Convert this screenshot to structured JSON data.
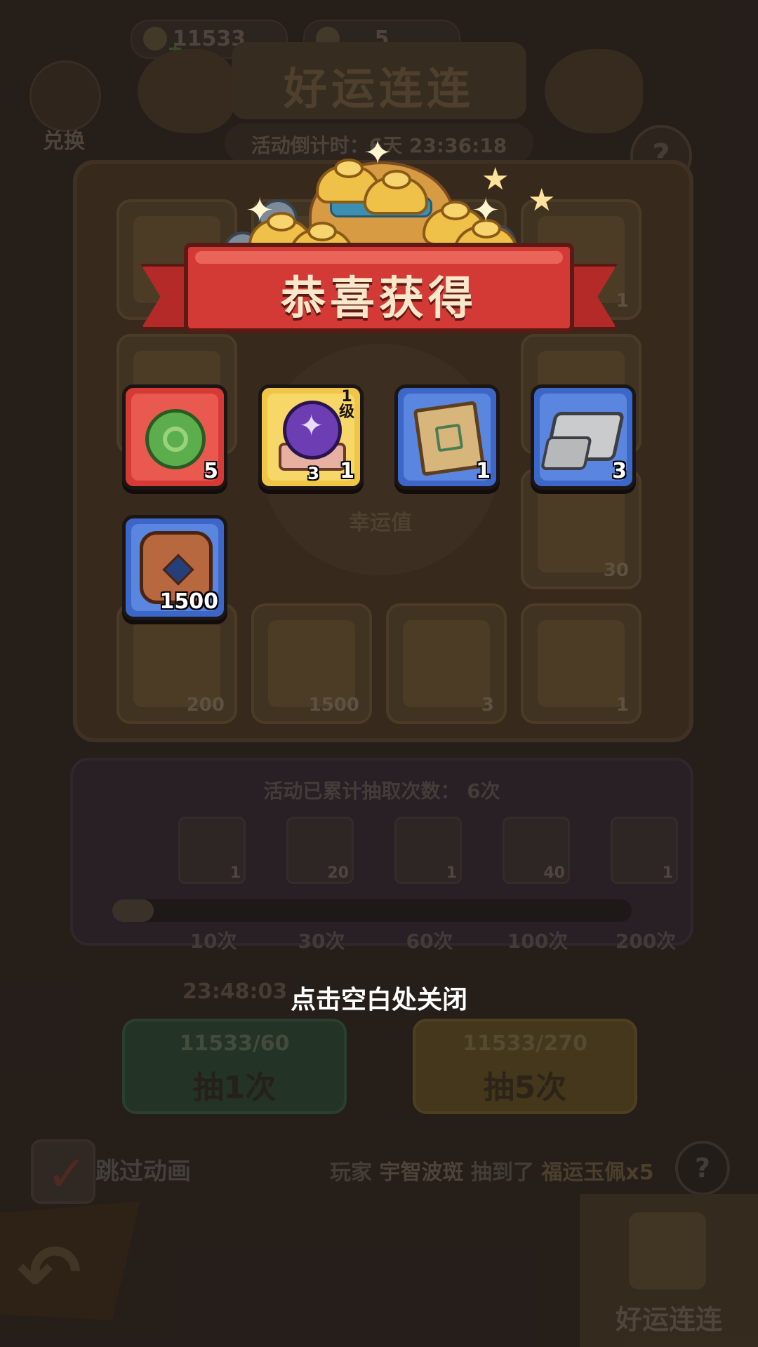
{
  "header": {
    "currency_gold": "11533",
    "currency_token": "5",
    "redeem_label": "兑换",
    "event_title": "好运连连",
    "countdown_text": "活动倒计时：6天 23:36:18",
    "help_icon": "?"
  },
  "board": {
    "cells": [
      {
        "count": ""
      },
      {
        "count": ""
      },
      {
        "count": ""
      },
      {
        "count": "1"
      },
      {
        "count": ""
      },
      {
        "count": ""
      },
      {
        "count": "30"
      },
      {
        "count": "200"
      },
      {
        "count": "1500"
      },
      {
        "count": "3"
      },
      {
        "count": "1"
      }
    ],
    "center_label": "幸运值"
  },
  "progress": {
    "header": "活动已累计抽取次数：  6次",
    "milestones": [
      {
        "label": "10次",
        "reward_count": "1"
      },
      {
        "label": "30次",
        "reward_count": "20"
      },
      {
        "label": "60次",
        "reward_count": "1"
      },
      {
        "label": "100次",
        "reward_count": "40"
      },
      {
        "label": "200次",
        "reward_count": "1"
      }
    ],
    "fill_fraction": 0.08
  },
  "draw": {
    "timer": "23:48:03",
    "single": {
      "cost": "11533/60",
      "label": "抽1次"
    },
    "multi": {
      "cost": "11533/270",
      "label": "抽5次"
    }
  },
  "footer": {
    "skip_label": "跳过动画",
    "ticker_prefix": "玩家",
    "ticker_name": "宇智波斑",
    "ticker_verb": "抽到了",
    "ticker_item": "福运玉佩x5",
    "nav_label": "好运连连"
  },
  "popup": {
    "title": "恭喜获得",
    "rewards": [
      {
        "icon": "jade-pendant-icon",
        "count": "5",
        "frame": "red"
      },
      {
        "icon": "purple-orb-icon",
        "count": "1",
        "level": "1\n级",
        "extra": "3",
        "frame": "yellow"
      },
      {
        "icon": "scroll-icon",
        "count": "1",
        "frame": "blue"
      },
      {
        "icon": "stone-icon",
        "count": "3",
        "frame": "blue"
      },
      {
        "icon": "bronze-coin-icon",
        "count": "1500",
        "frame": "blue"
      }
    ],
    "close_hint": "点击空白处关闭"
  }
}
